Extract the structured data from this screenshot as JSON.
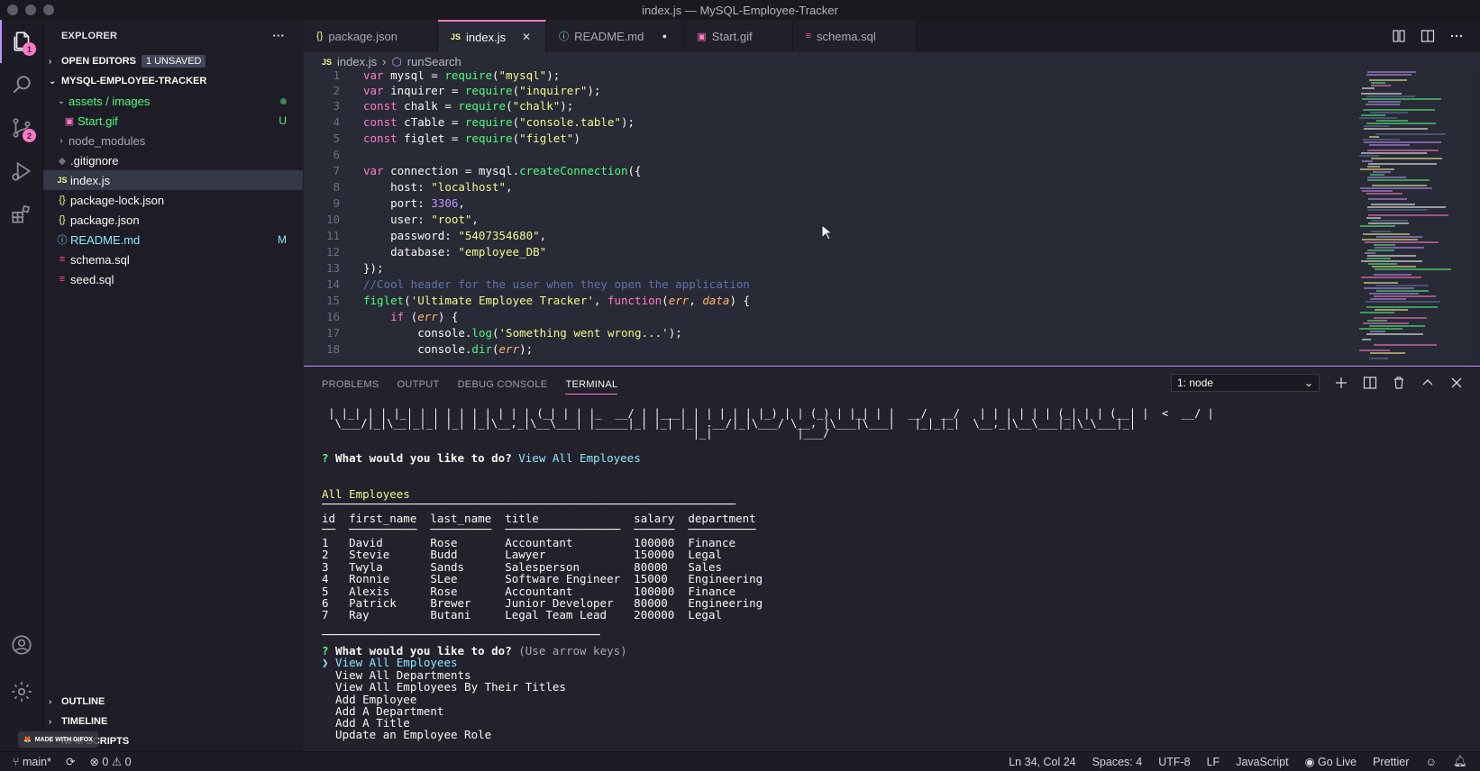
{
  "window": {
    "title": "index.js — MySQL-Employee-Tracker"
  },
  "activity_bar": {
    "explorer_badge": "1",
    "scm_badge": "2"
  },
  "sidebar": {
    "title": "EXPLORER",
    "more": "···",
    "open_editors": {
      "label": "OPEN EDITORS",
      "pill": "1 UNSAVED"
    },
    "project": {
      "label": "MYSQL-EMPLOYEE-TRACKER"
    },
    "items": [
      {
        "label": "assets / images",
        "status": ""
      },
      {
        "label": "Start.gif",
        "status": "U"
      },
      {
        "label": "node_modules",
        "status": ""
      },
      {
        "label": ".gitignore",
        "status": ""
      },
      {
        "label": "index.js",
        "status": ""
      },
      {
        "label": "package-lock.json",
        "status": ""
      },
      {
        "label": "package.json",
        "status": ""
      },
      {
        "label": "README.md",
        "status": "M"
      },
      {
        "label": "schema.sql",
        "status": ""
      },
      {
        "label": "seed.sql",
        "status": ""
      }
    ],
    "outline": "OUTLINE",
    "timeline": "TIMELINE",
    "npm_scripts": "NPM SCRIPTS"
  },
  "tabs": [
    {
      "label": "package.json",
      "icon": "{}"
    },
    {
      "label": "index.js",
      "icon": "JS",
      "close": "✕"
    },
    {
      "label": "README.md",
      "icon": "ⓘ",
      "dirty": "●"
    },
    {
      "label": "Start.gif",
      "icon": "▣"
    },
    {
      "label": "schema.sql",
      "icon": "≡"
    }
  ],
  "breadcrumb": {
    "file_icon": "JS",
    "file": "index.js",
    "sep": "›",
    "symbol": "runSearch"
  },
  "editor": {
    "line_numbers": [
      "1",
      "2",
      "3",
      "4",
      "5",
      "6",
      "7",
      "8",
      "9",
      "10",
      "11",
      "12",
      "13",
      "14",
      "15",
      "16",
      "17",
      "18"
    ],
    "line1": {
      "kw": "var",
      "name": " mysql = ",
      "fn": "require",
      "a": "(",
      "str": "\"mysql\"",
      "b": ");"
    },
    "line2": {
      "kw": "var",
      "name": " inquirer = ",
      "fn": "require",
      "a": "(",
      "str": "\"inquirer\"",
      "b": ");"
    },
    "line3": {
      "kw": "const",
      "name": " chalk = ",
      "fn": "require",
      "a": "(",
      "str": "\"chalk\"",
      "b": ");"
    },
    "line4": {
      "kw": "const",
      "name": " cTable = ",
      "fn": "require",
      "a": "(",
      "str": "\"console.table\"",
      "b": ");"
    },
    "line5": {
      "kw": "const",
      "name": " figlet = ",
      "fn": "require",
      "a": "(",
      "str": "\"figlet\"",
      "b": ")"
    },
    "line7": {
      "kw": "var",
      "name": " connection = mysql.",
      "fn": "createConnection",
      "b": "({"
    },
    "line8": {
      "key": "    host: ",
      "str": "\"localhost\"",
      "b": ","
    },
    "line9": {
      "key": "    port: ",
      "num": "3306",
      "b": ","
    },
    "line10": {
      "key": "    user: ",
      "str": "\"root\"",
      "b": ","
    },
    "line11": {
      "key": "    password: ",
      "str": "\"5407354680\"",
      "b": ","
    },
    "line12": {
      "key": "    database: ",
      "str": "\"employee_DB\""
    },
    "line13": {
      "b": "});"
    },
    "line14": {
      "comment": "//Cool header for the user when they open the application"
    },
    "line15": {
      "fn": "figlet",
      "a": "(",
      "str": "'Ultimate Employee Tracker'",
      "c": ", ",
      "kw": "function",
      "d": "(",
      "p1": "err",
      "e": ", ",
      "p2": "data",
      "b": ") {"
    },
    "line16": {
      "indent": "    ",
      "kw": "if",
      "a": " (",
      "p1": "err",
      "b": ") {"
    },
    "line17": {
      "indent": "        console.",
      "fn": "log",
      "a": "(",
      "str": "'Something went wrong...'",
      "b": ");"
    },
    "line18": {
      "indent": "        console.",
      "fn": "dir",
      "a": "(",
      "p1": "err",
      "b": ");"
    }
  },
  "panel": {
    "tabs": [
      "PROBLEMS",
      "OUTPUT",
      "DEBUG CONSOLE",
      "TERMINAL"
    ],
    "terminal_select": "1: node",
    "ascii_1": " | |_| | | |_| | | | | | | | | | (_| | | |_  __/ | |___| | | | | | |_) | | (_) | |_| | |  __/  __/   | | | | | | (_| | | (__| |  <  __/ |",
    "ascii_2": "  \\___/|_|\\__|_|_| |_| |_|\\__,_|\\__\\___| |_____|_| |_| |_| .__/|_|\\___/ \\__, |\\___|\\___|   |_|_|_|  \\__,_|\\__\\___|_|\\_\\___|_|",
    "ascii_3": "                                                         |_|             |___/",
    "q1_mark": "?",
    "q1_text": " What would you like to do?",
    "q1_answer": " View All Employees",
    "table_title": "All Employees",
    "table_rule": "─────────────────────────────────────────────────────────────",
    "table_header": "id  first_name  last_name  title              salary  department",
    "table_sep": "──  ──────────  ─────────  ─────────────────  ──────  ──────────",
    "rows": [
      "1   David       Rose       Accountant         100000  Finance",
      "2   Stevie      Budd       Lawyer             150000  Legal",
      "3   Twyla       Sands      Salesperson        80000   Sales",
      "4   Ronnie      SLee       Software Engineer  15000   Engineering",
      "5   Alexis      Rose       Accountant         100000  Finance",
      "6   Patrick     Brewer     Junior Developer   80000   Engineering",
      "7   Ray         Butani     Legal Team Lead    200000  Legal"
    ],
    "bottom_rule": "─────────────────────────────────────────",
    "q2_mark": "?",
    "q2_text": " What would you like to do?",
    "q2_hint": " (Use arrow keys)",
    "selected_option": "❯ View All Employees",
    "options": [
      "  View All Departments",
      "  View All Employees By Their Titles",
      "  Add Employee",
      "  Add A Department",
      "  Add A Title",
      "  Update an Employee Role"
    ]
  },
  "statusbar": {
    "branch": "main*",
    "errors": "0",
    "warnings": "0",
    "position": "Ln 34, Col 24",
    "spaces": "Spaces: 4",
    "encoding": "UTF-8",
    "eol": "LF",
    "language": "JavaScript",
    "golive": "Go Live",
    "prettier": "Prettier"
  },
  "watermark": "MADE WITH GIFOX"
}
